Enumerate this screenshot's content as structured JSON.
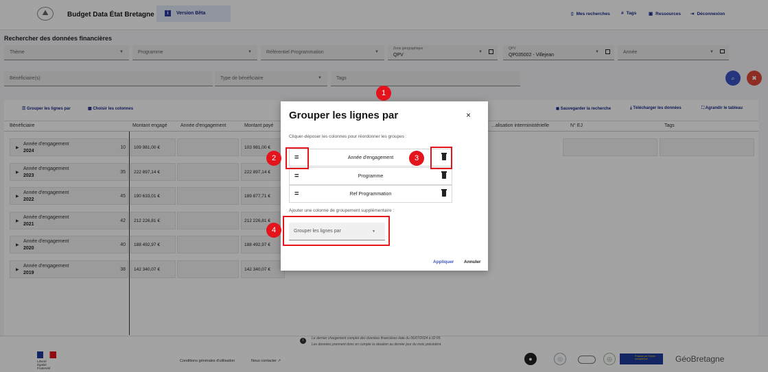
{
  "header": {
    "app_title": "Budget Data État Bretagne",
    "beta_label": "Version Bêta",
    "nav": [
      "Mes recherches",
      "Tags",
      "Ressources",
      "Déconnexion"
    ]
  },
  "search": {
    "title": "Rechercher des données financières",
    "theme": "Thème",
    "programme": "Programme",
    "referentiel": "Référentiel Programmation",
    "zone_label": "Zone géographique",
    "zone_value": "QPV",
    "qpv_label": "QPV",
    "qpv_value": "QP035002 - Villejean",
    "annee": "Année",
    "beneficiaires": "Bénéficiaire(s)",
    "type_beneficiaire": "Type de bénéficiaire",
    "tags": "Tags"
  },
  "toolbar": {
    "group": "Grouper les lignes par",
    "columns": "Choisir les colonnes",
    "save": "Sauvegarder la recherche",
    "download": "Télécharger les données",
    "expand": "Agrandir le tableau"
  },
  "table": {
    "headers": [
      "Bénéficiaire",
      "Montant engagé",
      "Année d'engagement",
      "Montant payé",
      "...alisation interministérielle",
      "N° EJ",
      "Tags"
    ],
    "rows": [
      {
        "label": "Année d'engagement",
        "year": "2024",
        "count": "10",
        "engage": "109 981,00 €",
        "paye": "103 981,00 €"
      },
      {
        "label": "Année d'engagement",
        "year": "2023",
        "count": "35",
        "engage": "222 897,14 €",
        "paye": "222 897,14 €"
      },
      {
        "label": "Année d'engagement",
        "year": "2022",
        "count": "45",
        "engage": "190 633,01 €",
        "paye": "189 877,71 €"
      },
      {
        "label": "Année d'engagement",
        "year": "2021",
        "count": "42",
        "engage": "212 226,81 €",
        "paye": "212 226,81 €"
      },
      {
        "label": "Année d'engagement",
        "year": "2020",
        "count": "40",
        "engage": "188 492,97 €",
        "paye": "188 492,97 €"
      },
      {
        "label": "Année d'engagement",
        "year": "2019",
        "count": "38",
        "engage": "142 340,07 €",
        "paye": "142 340,07 €"
      }
    ]
  },
  "footer": {
    "note1": "Le dernier chargement complet des données financières date du 06/07/2024 à 02:05.",
    "note2": "Les données prennent donc en compte la situation au dernier jour du mois précédent.",
    "marianne": [
      "Liberté",
      "Égalité",
      "Fraternité"
    ],
    "links": [
      "Conditions générales d'utilisation",
      "Nous contacter"
    ],
    "eu_text": "Financé par l'Union européenne",
    "geobretagne": "GéoBretagne"
  },
  "modal": {
    "title": "Grouper les lignes par",
    "subtitle": "Cliquer-déposer les colonnes pour réordonner les groupes :",
    "groups": [
      "Année d'engagement",
      "Programme",
      "Ref Programmation"
    ],
    "add_label": "Ajouter une colonne de groupement supplémentaire :",
    "select_placeholder": "Grouper les lignes par",
    "apply": "Appliquer",
    "cancel": "Annuler"
  },
  "annotations": [
    "1",
    "2",
    "3",
    "4"
  ],
  "colors": {
    "accent": "#1b2a8a",
    "annotation": "#e3141b",
    "search_btn": "#3b53c4",
    "clear_btn": "#e0473b"
  }
}
